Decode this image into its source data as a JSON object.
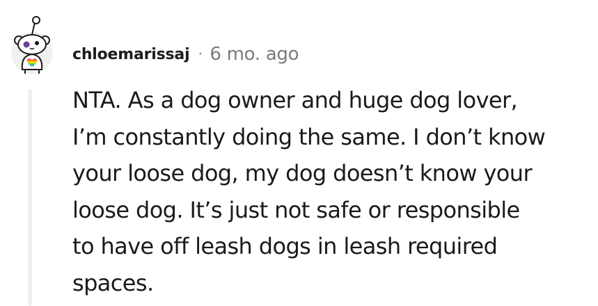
{
  "comment": {
    "username": "chloemarissaj",
    "separator": "·",
    "timestamp": "6 mo. ago",
    "avatar_icon": "reddit-snoo-avatar-icon",
    "body_lines": [
      "NTA. As a dog owner and huge dog lover,",
      "I’m constantly doing the same. I don’t know",
      "your loose dog, my dog doesn’t know your",
      "loose dog. It’s just not safe or responsible",
      "to have off leash dogs in leash required",
      "spaces."
    ]
  },
  "colors": {
    "username": "#1c1c1c",
    "timestamp": "#787c7e",
    "body_text": "#1a1a1b",
    "thread_line": "#edeff1",
    "avatar_bg": "#f0f0f0"
  }
}
